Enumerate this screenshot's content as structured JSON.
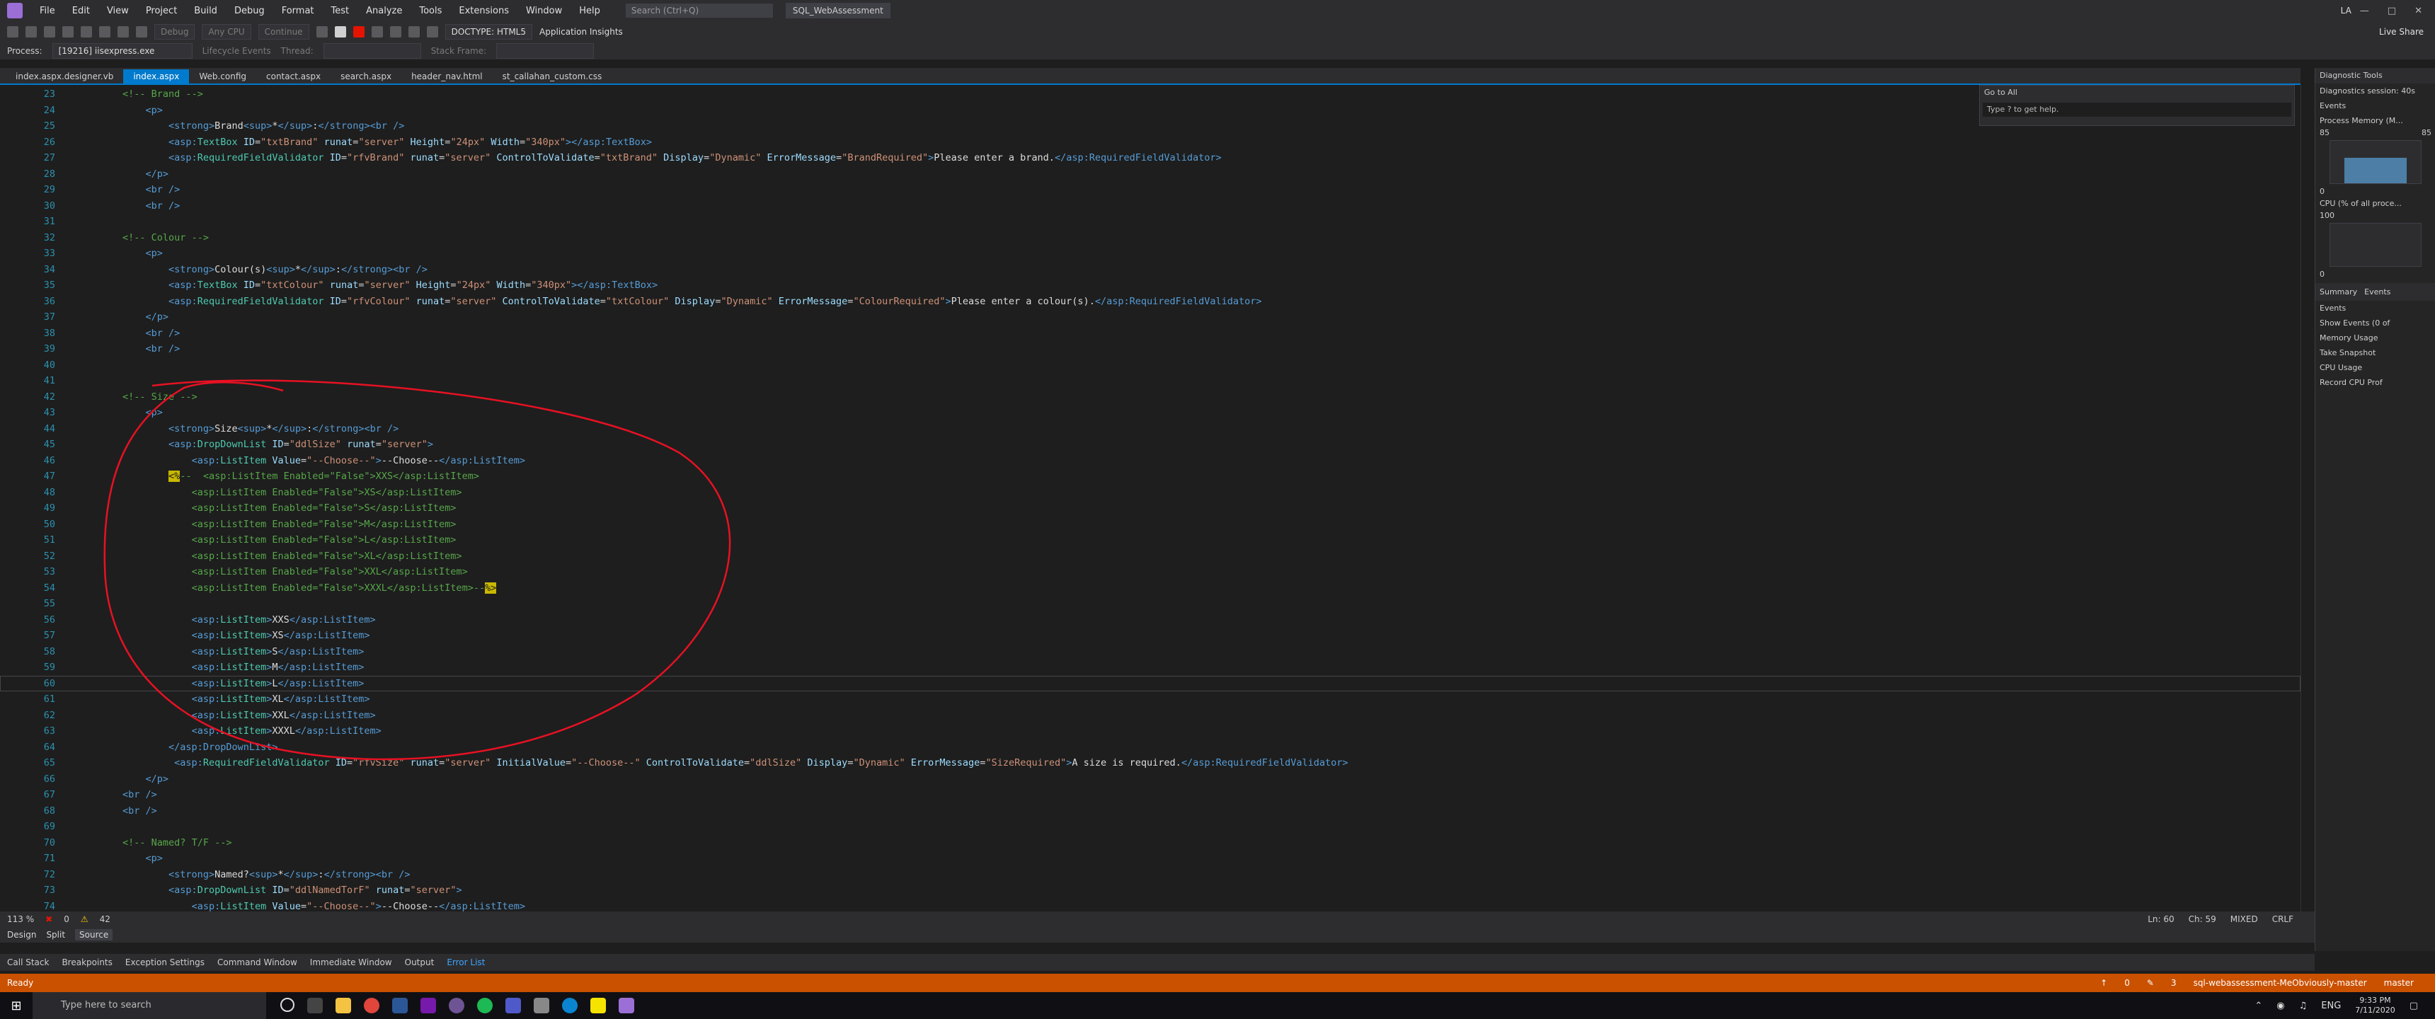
{
  "menubar": {
    "items": [
      "File",
      "Edit",
      "View",
      "Project",
      "Build",
      "Debug",
      "Format",
      "Test",
      "Analyze",
      "Tools",
      "Extensions",
      "Window",
      "Help"
    ],
    "search_placeholder": "Search (Ctrl+Q)",
    "solution": "SQL_WebAssessment",
    "user_initials": "LA"
  },
  "toolbar": {
    "config": "Debug",
    "platform": "Any CPU",
    "continue_label": "Continue",
    "doctype": "DOCTYPE: HTML5",
    "app_insights": "Application Insights",
    "live_share": "Live Share"
  },
  "processbar": {
    "process_label": "Process:",
    "process_value": "[19216] iisexpress.exe",
    "lifecycle": "Lifecycle Events",
    "thread": "Thread:",
    "stack_frame": "Stack Frame:"
  },
  "tabs": [
    {
      "label": "index.aspx.designer.vb",
      "active": false
    },
    {
      "label": "index.aspx",
      "active": true
    },
    {
      "label": "Web.config",
      "active": false
    },
    {
      "label": "contact.aspx",
      "active": false
    },
    {
      "label": "search.aspx",
      "active": false
    },
    {
      "label": "header_nav.html",
      "active": false
    },
    {
      "label": "st_callahan_custom.css",
      "active": false
    }
  ],
  "goto": {
    "title": "Go to All",
    "placeholder": "Type ? to get help."
  },
  "code": [
    {
      "n": "23",
      "html": "        <span class='cmt'>&lt;!-- Brand --&gt;</span>"
    },
    {
      "n": "24",
      "html": "            <span class='tag'>&lt;p&gt;</span>"
    },
    {
      "n": "25",
      "html": "                <span class='tag'>&lt;strong&gt;</span><span class='txt'>Brand</span><span class='tag'>&lt;sup&gt;</span><span class='txt'>*</span><span class='tag'>&lt;/sup&gt;</span><span class='txt'>:</span><span class='tag'>&lt;/strong&gt;&lt;br /&gt;</span>"
    },
    {
      "n": "26",
      "html": "                <span class='tag'>&lt;asp:</span><span class='asp'>TextBox</span> <span class='attr'>ID</span>=<span class='val'>\"txtBrand\"</span> <span class='attr'>runat</span>=<span class='val'>\"server\"</span> <span class='attr'>Height</span>=<span class='val'>\"24px\"</span> <span class='attr'>Width</span>=<span class='val'>\"340px\"</span><span class='tag'>&gt;&lt;/asp:TextBox&gt;</span>"
    },
    {
      "n": "27",
      "html": "                <span class='tag'>&lt;asp:</span><span class='asp'>RequiredFieldValidator</span> <span class='attr'>ID</span>=<span class='val'>\"rfvBrand\"</span> <span class='attr'>runat</span>=<span class='val'>\"server\"</span> <span class='attr'>ControlToValidate</span>=<span class='val'>\"txtBrand\"</span> <span class='attr'>Display</span>=<span class='val'>\"Dynamic\"</span> <span class='attr'>ErrorMessage</span>=<span class='val'>\"BrandRequired\"</span><span class='tag'>&gt;</span><span class='txt'>Please enter a brand.</span><span class='tag'>&lt;/asp:RequiredFieldValidator&gt;</span>"
    },
    {
      "n": "28",
      "html": "            <span class='tag'>&lt;/p&gt;</span>"
    },
    {
      "n": "29",
      "html": "            <span class='tag'>&lt;br /&gt;</span>"
    },
    {
      "n": "30",
      "html": "            <span class='tag'>&lt;br /&gt;</span>"
    },
    {
      "n": "31",
      "html": ""
    },
    {
      "n": "32",
      "html": "        <span class='cmt'>&lt;!-- Colour --&gt;</span>"
    },
    {
      "n": "33",
      "html": "            <span class='tag'>&lt;p&gt;</span>"
    },
    {
      "n": "34",
      "html": "                <span class='tag'>&lt;strong&gt;</span><span class='txt'>Colour(s)</span><span class='tag'>&lt;sup&gt;</span><span class='txt'>*</span><span class='tag'>&lt;/sup&gt;</span><span class='txt'>:</span><span class='tag'>&lt;/strong&gt;&lt;br /&gt;</span>"
    },
    {
      "n": "35",
      "html": "                <span class='tag'>&lt;asp:</span><span class='asp'>TextBox</span> <span class='attr'>ID</span>=<span class='val'>\"txtColour\"</span> <span class='attr'>runat</span>=<span class='val'>\"server\"</span> <span class='attr'>Height</span>=<span class='val'>\"24px\"</span> <span class='attr'>Width</span>=<span class='val'>\"340px\"</span><span class='tag'>&gt;&lt;/asp:TextBox&gt;</span>"
    },
    {
      "n": "36",
      "html": "                <span class='tag'>&lt;asp:</span><span class='asp'>RequiredFieldValidator</span> <span class='attr'>ID</span>=<span class='val'>\"rfvColour\"</span> <span class='attr'>runat</span>=<span class='val'>\"server\"</span> <span class='attr'>ControlToValidate</span>=<span class='val'>\"txtColour\"</span> <span class='attr'>Display</span>=<span class='val'>\"Dynamic\"</span> <span class='attr'>ErrorMessage</span>=<span class='val'>\"ColourRequired\"</span><span class='tag'>&gt;</span><span class='txt'>Please enter a colour(s).</span><span class='tag'>&lt;/asp:RequiredFieldValidator&gt;</span>"
    },
    {
      "n": "37",
      "html": "            <span class='tag'>&lt;/p&gt;</span>"
    },
    {
      "n": "38",
      "html": "            <span class='tag'>&lt;br /&gt;</span>"
    },
    {
      "n": "39",
      "html": "            <span class='tag'>&lt;br /&gt;</span>"
    },
    {
      "n": "40",
      "html": ""
    },
    {
      "n": "41",
      "html": ""
    },
    {
      "n": "42",
      "html": "        <span class='cmt'>&lt;!-- Size --&gt;</span>"
    },
    {
      "n": "43",
      "html": "            <span class='tag'>&lt;p&gt;</span>"
    },
    {
      "n": "44",
      "html": "                <span class='tag'>&lt;strong&gt;</span><span class='txt'>Size</span><span class='tag'>&lt;sup&gt;</span><span class='txt'>*</span><span class='tag'>&lt;/sup&gt;</span><span class='txt'>:</span><span class='tag'>&lt;/strong&gt;&lt;br /&gt;</span>"
    },
    {
      "n": "45",
      "html": "                <span class='tag'>&lt;asp:</span><span class='asp'>DropDownList</span> <span class='attr'>ID</span>=<span class='val'>\"ddlSize\"</span> <span class='attr'>runat</span>=<span class='val'>\"server\"</span><span class='tag'>&gt;</span>"
    },
    {
      "n": "46",
      "html": "                    <span class='tag'>&lt;asp:</span><span class='asp'>ListItem</span> <span class='attr'>Value</span>=<span class='val'>\"--Choose--\"</span><span class='tag'>&gt;</span><span class='txt'>--Choose--</span><span class='tag'>&lt;/asp:ListItem&gt;</span>"
    },
    {
      "n": "47",
      "html": "                <span class='hl'>&lt;%</span><span class='cmt'>--  &lt;asp:ListItem Enabled=\"False\"&gt;XXS&lt;/asp:ListItem&gt;</span>"
    },
    {
      "n": "48",
      "html": "                    <span class='cmt'>&lt;asp:ListItem Enabled=\"False\"&gt;XS&lt;/asp:ListItem&gt;</span>"
    },
    {
      "n": "49",
      "html": "                    <span class='cmt'>&lt;asp:ListItem Enabled=\"False\"&gt;S&lt;/asp:ListItem&gt;</span>"
    },
    {
      "n": "50",
      "html": "                    <span class='cmt'>&lt;asp:ListItem Enabled=\"False\"&gt;M&lt;/asp:ListItem&gt;</span>"
    },
    {
      "n": "51",
      "html": "                    <span class='cmt'>&lt;asp:ListItem Enabled=\"False\"&gt;L&lt;/asp:ListItem&gt;</span>"
    },
    {
      "n": "52",
      "html": "                    <span class='cmt'>&lt;asp:ListItem Enabled=\"False\"&gt;XL&lt;/asp:ListItem&gt;</span>"
    },
    {
      "n": "53",
      "html": "                    <span class='cmt'>&lt;asp:ListItem Enabled=\"False\"&gt;XXL&lt;/asp:ListItem&gt;</span>"
    },
    {
      "n": "54",
      "html": "                    <span class='cmt'>&lt;asp:ListItem Enabled=\"False\"&gt;XXXL&lt;/asp:ListItem&gt;--</span><span class='hl'>%&gt;</span>"
    },
    {
      "n": "55",
      "html": ""
    },
    {
      "n": "56",
      "html": "                    <span class='tag'>&lt;asp:</span><span class='asp'>ListItem</span><span class='tag'>&gt;</span><span class='txt'>XXS</span><span class='tag'>&lt;/asp:ListItem&gt;</span>"
    },
    {
      "n": "57",
      "html": "                    <span class='tag'>&lt;asp:</span><span class='asp'>ListItem</span><span class='tag'>&gt;</span><span class='txt'>XS</span><span class='tag'>&lt;/asp:ListItem&gt;</span>"
    },
    {
      "n": "58",
      "html": "                    <span class='tag'>&lt;asp:</span><span class='asp'>ListItem</span><span class='tag'>&gt;</span><span class='txt'>S</span><span class='tag'>&lt;/asp:ListItem&gt;</span>"
    },
    {
      "n": "59",
      "html": "                    <span class='tag'>&lt;asp:</span><span class='asp'>ListItem</span><span class='tag'>&gt;</span><span class='txt'>M</span><span class='tag'>&lt;/asp:ListItem&gt;</span>"
    },
    {
      "n": "60",
      "html": "                    <span class='tag'>&lt;asp:</span><span class='asp'>ListItem</span><span class='tag'>&gt;</span><span class='txt'>L</span><span class='tag'>&lt;/asp:ListItem&gt;</span>",
      "current": true
    },
    {
      "n": "61",
      "html": "                    <span class='tag'>&lt;asp:</span><span class='asp'>ListItem</span><span class='tag'>&gt;</span><span class='txt'>XL</span><span class='tag'>&lt;/asp:ListItem&gt;</span>"
    },
    {
      "n": "62",
      "html": "                    <span class='tag'>&lt;asp:</span><span class='asp'>ListItem</span><span class='tag'>&gt;</span><span class='txt'>XXL</span><span class='tag'>&lt;/asp:ListItem&gt;</span>"
    },
    {
      "n": "63",
      "html": "                    <span class='tag'>&lt;asp:</span><span class='asp'>ListItem</span><span class='tag'>&gt;</span><span class='txt'>XXXL</span><span class='tag'>&lt;/asp:ListItem&gt;</span>"
    },
    {
      "n": "64",
      "html": "                <span class='tag'>&lt;/asp:DropDownList&gt;</span>"
    },
    {
      "n": "65",
      "html": "                 <span class='tag'>&lt;asp:</span><span class='asp'>RequiredFieldValidator</span> <span class='attr'>ID</span>=<span class='val'>\"rfvSize\"</span> <span class='attr'>runat</span>=<span class='val'>\"server\"</span> <span class='attr'>InitialValue</span>=<span class='val'>\"--Choose--\"</span> <span class='attr'>ControlToValidate</span>=<span class='val'>\"ddlSize\"</span> <span class='attr'>Display</span>=<span class='val'>\"Dynamic\"</span> <span class='attr'>ErrorMessage</span>=<span class='val'>\"SizeRequired\"</span><span class='tag'>&gt;</span><span class='txt'>A size is required.</span><span class='tag'>&lt;/asp:RequiredFieldValidator&gt;</span>"
    },
    {
      "n": "66",
      "html": "            <span class='tag'>&lt;/p&gt;</span>"
    },
    {
      "n": "67",
      "html": "        <span class='tag'>&lt;br /&gt;</span>"
    },
    {
      "n": "68",
      "html": "        <span class='tag'>&lt;br /&gt;</span>"
    },
    {
      "n": "69",
      "html": ""
    },
    {
      "n": "70",
      "html": "        <span class='cmt'>&lt;!-- Named? T/F --&gt;</span>"
    },
    {
      "n": "71",
      "html": "            <span class='tag'>&lt;p&gt;</span>"
    },
    {
      "n": "72",
      "html": "                <span class='tag'>&lt;strong&gt;</span><span class='txt'>Named?</span><span class='tag'>&lt;sup&gt;</span><span class='txt'>*</span><span class='tag'>&lt;/sup&gt;</span><span class='txt'>:</span><span class='tag'>&lt;/strong&gt;&lt;br /&gt;</span>"
    },
    {
      "n": "73",
      "html": "                <span class='tag'>&lt;asp:</span><span class='asp'>DropDownList</span> <span class='attr'>ID</span>=<span class='val'>\"ddlNamedTorF\"</span> <span class='attr'>runat</span>=<span class='val'>\"server\"</span><span class='tag'>&gt;</span>"
    },
    {
      "n": "74",
      "html": "                    <span class='tag'>&lt;asp:</span><span class='asp'>ListItem</span> <span class='attr'>Value</span>=<span class='val'>\"--Choose--\"</span><span class='tag'>&gt;</span><span class='txt'>--Choose--</span><span class='tag'>&lt;/asp:ListItem&gt;</span>"
    }
  ],
  "diag": {
    "title": "Diagnostic Tools",
    "session": "Diagnostics session: 40s",
    "events": "Events",
    "memory": "Process Memory (M...",
    "mem_left": "85",
    "mem_right": "85",
    "mem_zero": "0",
    "cpu": "CPU (% of all proce...",
    "cpu_max": "100",
    "cpu_zero": "0",
    "tabs": [
      "Summary",
      "Events"
    ],
    "events_section": "Events",
    "show_events": "Show Events (0 of",
    "memory_usage": "Memory Usage",
    "take_snapshot": "Take Snapshot",
    "cpu_usage": "CPU Usage",
    "record_cpu": "Record CPU Prof"
  },
  "editor_status": {
    "zoom": "113 %",
    "errors": "0",
    "warnings": "42",
    "ln": "Ln: 60",
    "ch": "Ch: 59",
    "mode": "MIXED",
    "eol": "CRLF"
  },
  "viewbar": [
    "Design",
    "Split",
    "Source"
  ],
  "toolwin_tabs": [
    "Call Stack",
    "Breakpoints",
    "Exception Settings",
    "Command Window",
    "Immediate Window",
    "Output",
    "Error List"
  ],
  "status": {
    "ready": "Ready",
    "up": "0",
    "pencil": "3",
    "repo": "sql-webassessment-MeObviously-master",
    "branch": "master"
  },
  "taskbar": {
    "search_placeholder": "Type here to search",
    "lang": "ENG",
    "time": "9:33 PM",
    "date": "7/11/2020"
  },
  "colors": {
    "accent": "#007acc",
    "status": "#ca5100",
    "annotation": "#e81123"
  }
}
